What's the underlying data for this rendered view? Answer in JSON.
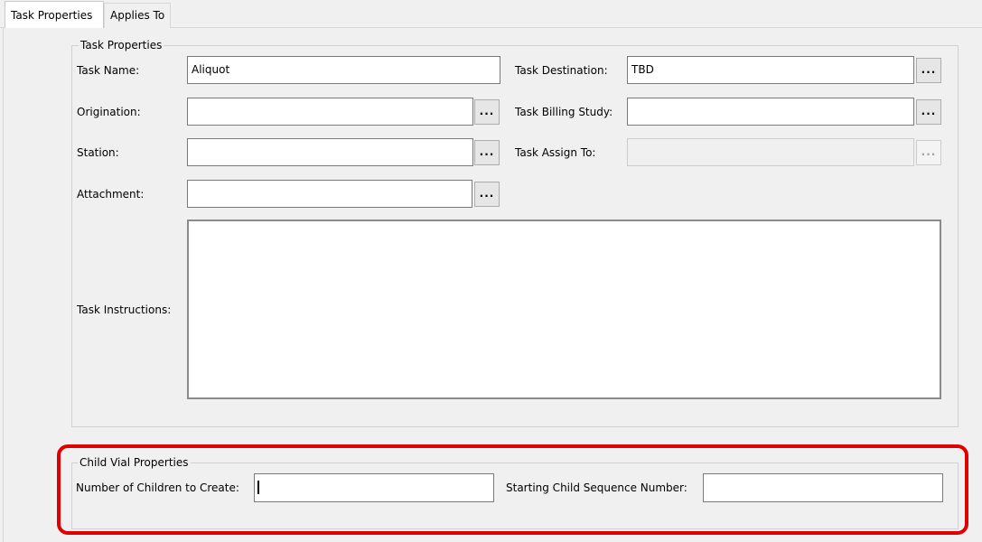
{
  "tabs": [
    {
      "label": "Task Properties",
      "active": true
    },
    {
      "label": "Applies To",
      "active": false
    }
  ],
  "task_properties": {
    "group_title": "Task Properties",
    "task_name": {
      "label": "Task Name:",
      "value": "Aliquot"
    },
    "task_destination": {
      "label": "Task Destination:",
      "value": "TBD"
    },
    "origination": {
      "label": "Origination:",
      "value": ""
    },
    "task_billing_study": {
      "label": "Task Billing Study:",
      "value": ""
    },
    "station": {
      "label": "Station:",
      "value": ""
    },
    "task_assign_to": {
      "label": "Task Assign To:",
      "value": "",
      "disabled": true
    },
    "attachment": {
      "label": "Attachment:",
      "value": ""
    },
    "task_instructions": {
      "label": "Task Instructions:",
      "value": ""
    },
    "browse_label": "..."
  },
  "child_vial_properties": {
    "group_title": "Child Vial Properties",
    "number_of_children": {
      "label": "Number of Children to Create:",
      "value": ""
    },
    "starting_sequence": {
      "label": "Starting Child Sequence Number:",
      "value": ""
    }
  },
  "colors": {
    "highlight": "#e00000",
    "window_bg": "#f0f0f0",
    "field_bg": "#ffffff"
  },
  "icons": {
    "browse": "ellipsis-icon"
  }
}
